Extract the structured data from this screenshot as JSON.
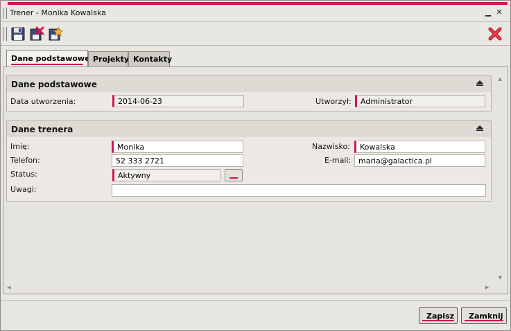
{
  "window": {
    "title": "Trener - Monika Kowalska",
    "minimize_glyph": "▁",
    "close_glyph": "✕"
  },
  "toolbar": {
    "buttons": [
      {
        "name": "save-icon"
      },
      {
        "name": "delete-icon"
      },
      {
        "name": "new-icon"
      }
    ],
    "close_icon": "close-icon"
  },
  "tabs": [
    {
      "label": "Dane podstawowe",
      "active": true
    },
    {
      "label": "Projekty",
      "active": false
    },
    {
      "label": "Kontakty",
      "active": false
    }
  ],
  "sections": {
    "basic": {
      "title": "Dane podstawowe",
      "created_label": "Data utworzenia:",
      "created_value": "2014-06-23",
      "author_label": "Utworzył:",
      "author_value": "Administrator"
    },
    "trainer": {
      "title": "Dane trenera",
      "first_name_label": "Imię:",
      "first_name_value": "Monika",
      "last_name_label": "Nazwisko:",
      "last_name_value": "Kowalska",
      "phone_label": "Telefon:",
      "phone_value": "52 333 2721",
      "email_label": "E-mail:",
      "email_value": "maria@galactica.pl",
      "status_label": "Status:",
      "status_value": "Aktywny",
      "notes_label": "Uwagi:",
      "notes_value": ""
    }
  },
  "footer": {
    "save_label": "Zapisz",
    "close_label": "Zamknij"
  },
  "colors": {
    "accent": "#d0174f",
    "background": "#e9e7e2"
  }
}
